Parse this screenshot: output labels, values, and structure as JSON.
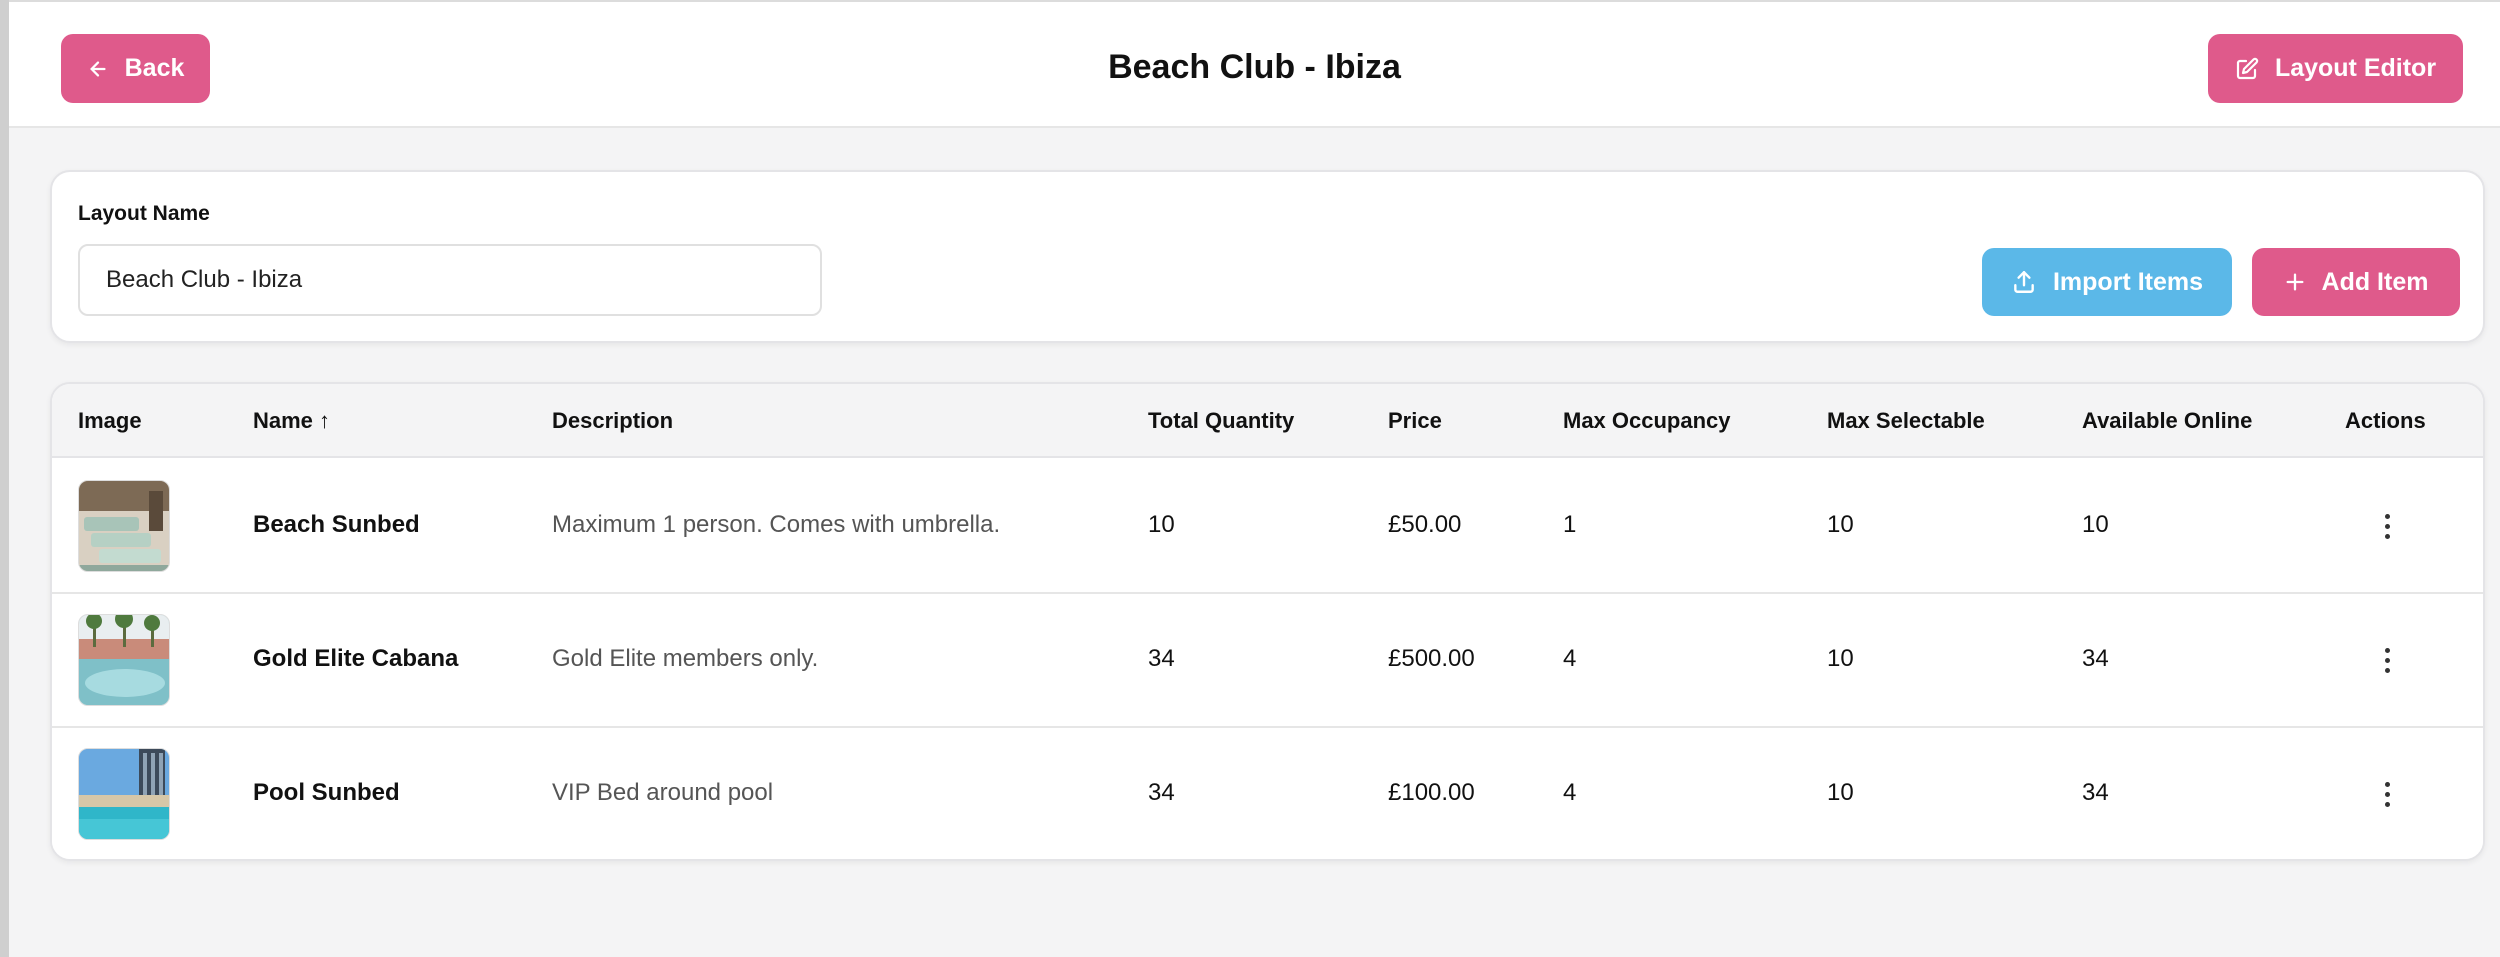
{
  "header": {
    "title": "Beach Club - Ibiza",
    "back_label": "Back",
    "layout_editor_label": "Layout Editor",
    "accent_color": "#df5a8b"
  },
  "layout_form": {
    "label": "Layout Name",
    "value": "Beach Club - Ibiza",
    "import_label": "Import Items",
    "add_label": "Add Item",
    "import_color": "#5bb8e8"
  },
  "table": {
    "columns": [
      "Image",
      "Name ↑",
      "Description",
      "Total Quantity",
      "Price",
      "Max Occupancy",
      "Max Selectable",
      "Available Online",
      "Actions"
    ],
    "rows": [
      {
        "name": "Beach Sunbed",
        "description": "Maximum 1 person. Comes with umbrella.",
        "total_quantity": "10",
        "price": "£50.00",
        "max_occupancy": "1",
        "max_selectable": "10",
        "available_online": "10"
      },
      {
        "name": "Gold Elite Cabana",
        "description": "Gold Elite members only.",
        "total_quantity": "34",
        "price": "£500.00",
        "max_occupancy": "4",
        "max_selectable": "10",
        "available_online": "34"
      },
      {
        "name": "Pool Sunbed",
        "description": "VIP Bed around pool",
        "total_quantity": "34",
        "price": "£100.00",
        "max_occupancy": "4",
        "max_selectable": "10",
        "available_online": "34"
      }
    ]
  }
}
